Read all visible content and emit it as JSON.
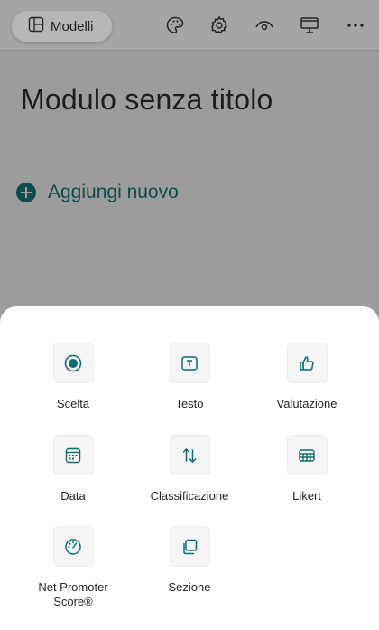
{
  "toolbar": {
    "models_label": "Modelli",
    "icons": [
      "palette-icon",
      "gear-icon",
      "preview-eye-icon",
      "present-icon",
      "more-icon"
    ]
  },
  "form": {
    "title": "Modulo senza titolo",
    "add_new_label": "Aggiungi nuovo"
  },
  "question_types": [
    {
      "label": "Scelta",
      "icon": "radio-choice-icon"
    },
    {
      "label": "Testo",
      "icon": "text-box-icon"
    },
    {
      "label": "Valutazione",
      "icon": "thumbs-up-icon"
    },
    {
      "label": "Data",
      "icon": "calendar-icon"
    },
    {
      "label": "Classificazione",
      "icon": "ranking-arrows-icon"
    },
    {
      "label": "Likert",
      "icon": "likert-grid-icon"
    },
    {
      "label": "Net Promoter Score®",
      "icon": "gauge-icon"
    },
    {
      "label": "Sezione",
      "icon": "section-icon"
    }
  ],
  "colors": {
    "accent": "#0f6b70",
    "overlay": "#9c9c9c",
    "sheet": "#ffffff"
  }
}
